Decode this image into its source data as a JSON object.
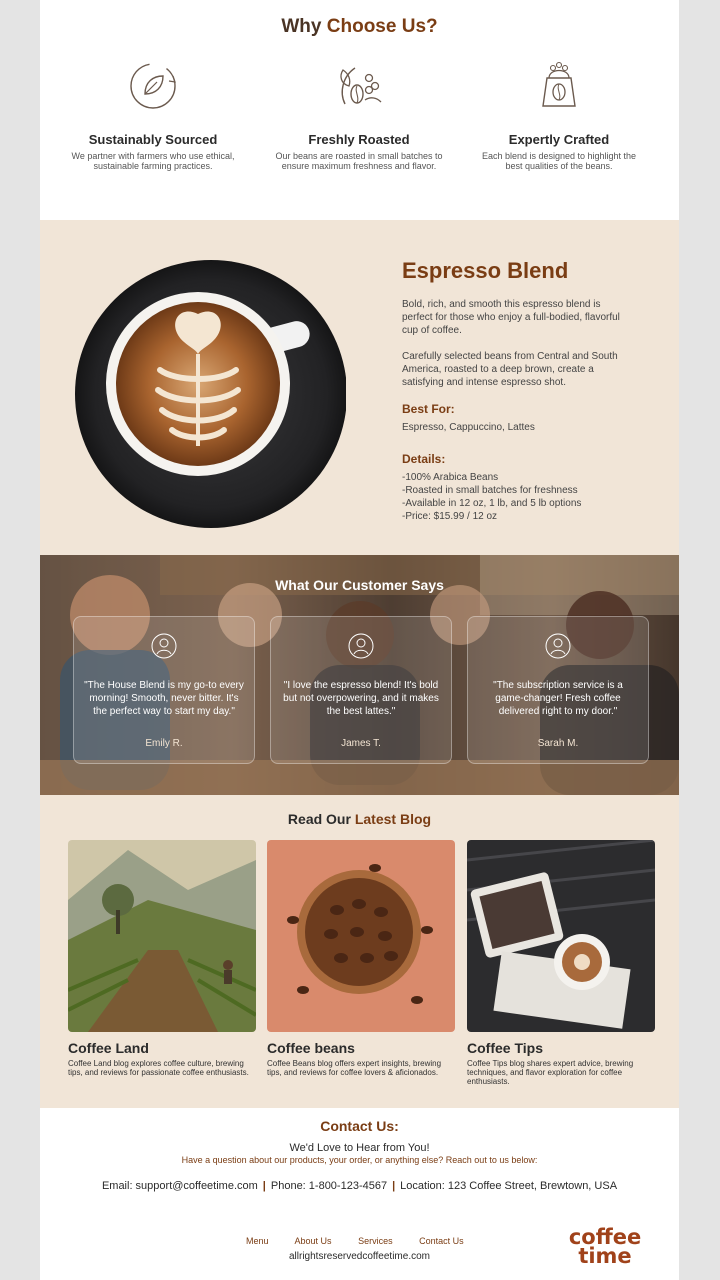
{
  "why": {
    "title_plain": "Why",
    "title_accent": "Choose Us?",
    "features": [
      {
        "icon": "leaf-recycle-icon",
        "title": "Sustainably Sourced",
        "desc": "We partner with farmers who use ethical, sustainable farming practices."
      },
      {
        "icon": "coffee-bean-branch-icon",
        "title": "Freshly Roasted",
        "desc": "Our beans are roasted in small batches to ensure maximum freshness and flavor."
      },
      {
        "icon": "coffee-bag-icon",
        "title": "Expertly Crafted",
        "desc": "Each blend is designed to highlight the best qualities of the beans."
      }
    ]
  },
  "espresso": {
    "title": "Espresso Blend",
    "p1": "Bold, rich, and smooth this espresso blend is perfect for those who enjoy a full-bodied, flavorful cup of coffee.",
    "p2": "Carefully selected beans from Central and South America, roasted to a deep brown, create a satisfying and intense espresso shot.",
    "best_for_label": "Best For:",
    "best_for": "Espresso, Cappuccino, Lattes",
    "details_label": "Details:",
    "details": [
      "-100% Arabica Beans",
      "-Roasted in small batches for freshness",
      "-Available in 12 oz, 1 lb, and 5 lb options",
      "-Price: $15.99 / 12 oz"
    ]
  },
  "testimonials": {
    "title": "What Our Customer Says",
    "items": [
      {
        "quote": "\"The House Blend is my go-to every morning! Smooth, never bitter. It's the perfect way to start my day.\"",
        "name": "Emily R."
      },
      {
        "quote": "\"I love the espresso blend! It's bold but not overpowering, and it makes the best lattes.\"",
        "name": "James T."
      },
      {
        "quote": "\"The subscription service is a game-changer! Fresh coffee delivered right to my door.\"",
        "name": "Sarah M."
      }
    ]
  },
  "blog": {
    "title_plain": "Read Our",
    "title_accent": "Latest Blog",
    "posts": [
      {
        "title": "Coffee Land",
        "desc": "Coffee Land blog explores coffee culture, brewing tips, and reviews for passionate coffee enthusiasts."
      },
      {
        "title": "Coffee beans",
        "desc": "Coffee Beans blog offers expert insights, brewing tips, and reviews for coffee lovers & aficionados."
      },
      {
        "title": "Coffee Tips",
        "desc": "Coffee Tips blog shares expert advice, brewing techniques, and flavor exploration for coffee enthusiasts."
      }
    ]
  },
  "contact": {
    "title": "Contact Us:",
    "subtitle": "We'd Love to Hear from You!",
    "question": "Have a question about our products, your order, or anything else? Reach out to us below:",
    "email": "Email: support@coffeetime.com",
    "phone": "Phone: 1-800-123-4567",
    "location": "Location: 123 Coffee Street, Brewtown, USA",
    "sep": "|"
  },
  "footer": {
    "nav": [
      "Menu",
      "About Us",
      "Services",
      "Contact Us"
    ],
    "copyright": "allrightsreservedcoffeetime.com",
    "logo_line1": "coffee",
    "logo_line2": "time"
  },
  "colors": {
    "accent": "#7a3d14",
    "cream": "#f1e5d7",
    "text": "#2b2b2b"
  }
}
